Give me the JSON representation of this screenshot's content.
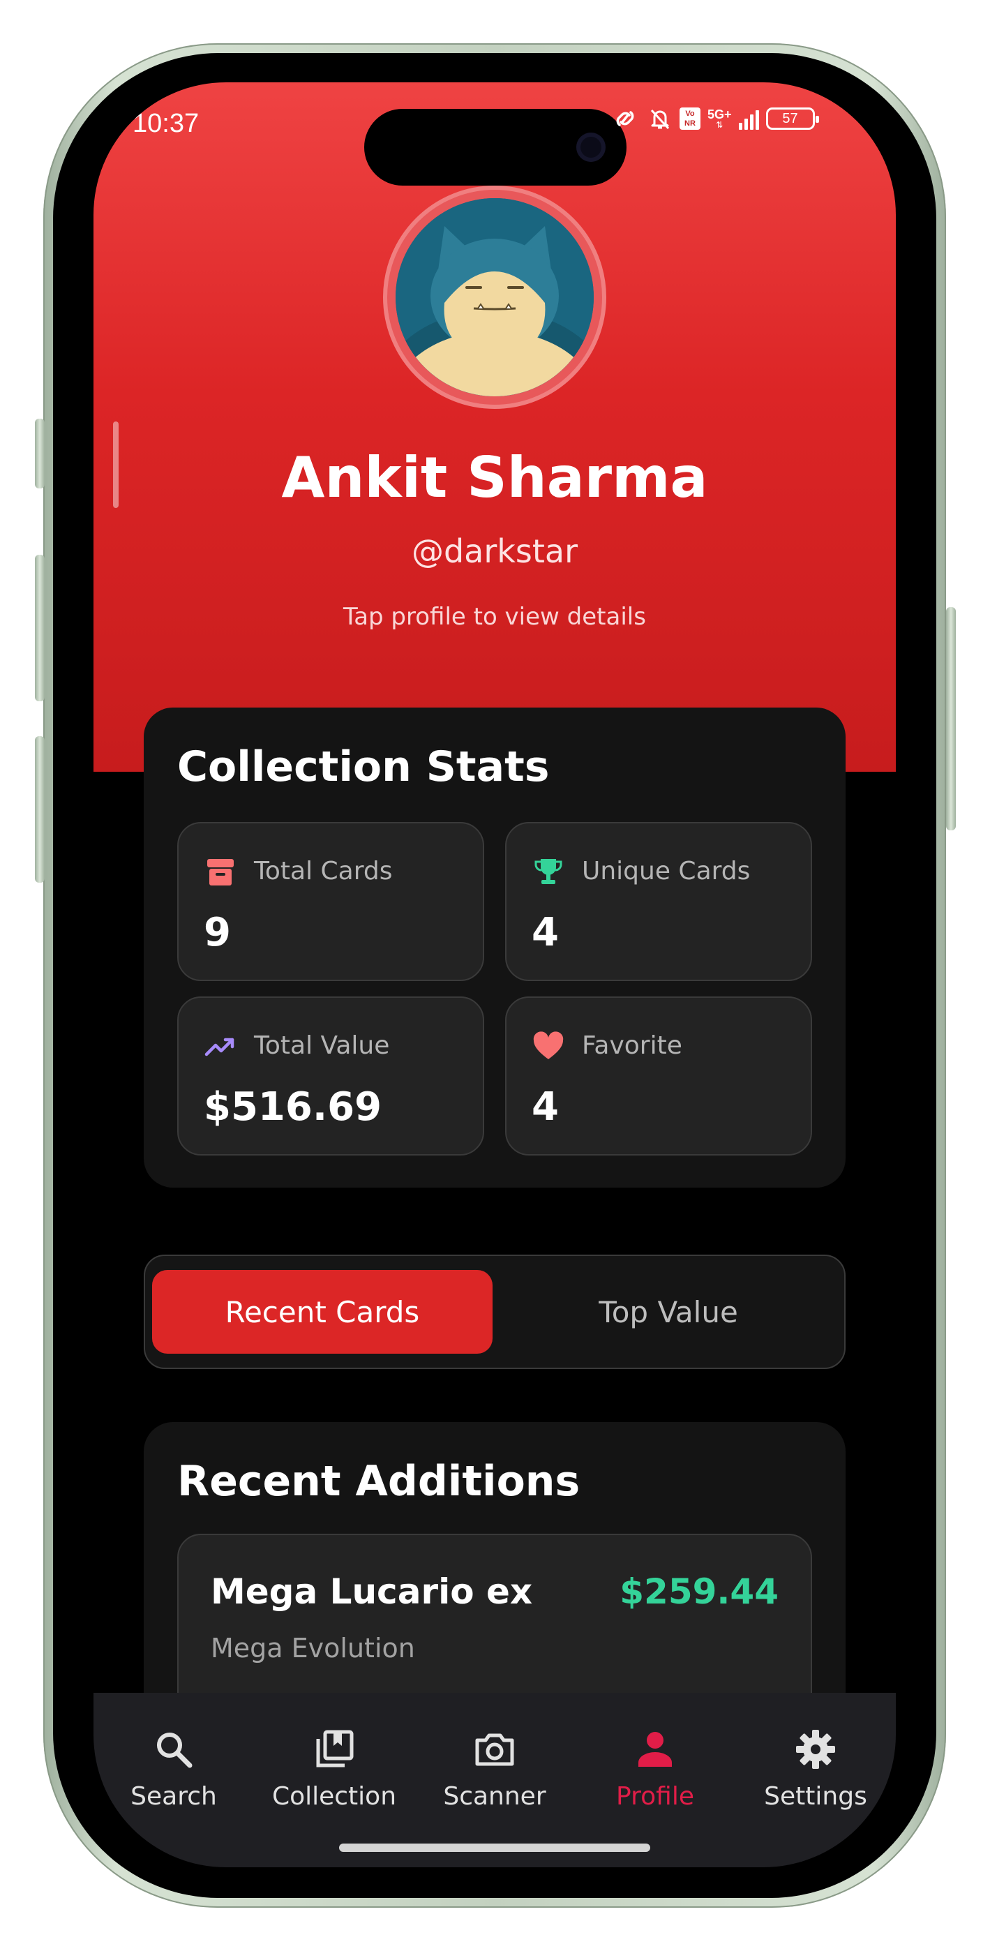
{
  "status_bar": {
    "time": "10:37",
    "network_top": "5G+",
    "volte": "Vo NR",
    "battery": "57"
  },
  "profile": {
    "name": "Ankit Sharma",
    "handle": "@darkstar",
    "hint": "Tap profile to view details"
  },
  "stats": {
    "title": "Collection Stats",
    "total_cards": {
      "label": "Total Cards",
      "value": "9",
      "icon": "archive-icon",
      "color": "#f87171"
    },
    "unique_cards": {
      "label": "Unique Cards",
      "value": "4",
      "icon": "trophy-icon",
      "color": "#34d399"
    },
    "total_value": {
      "label": "Total Value",
      "value": "$516.69",
      "icon": "trending-up-icon",
      "color": "#a78bfa"
    },
    "favorite": {
      "label": "Favorite",
      "value": "4",
      "icon": "heart-icon",
      "color": "#f87171"
    }
  },
  "tabs": {
    "active": "Recent Cards",
    "inactive": "Top Value"
  },
  "recent": {
    "title": "Recent Additions",
    "items": [
      {
        "name": "Mega Lucario ex",
        "price": "$259.44",
        "set": "Mega Evolution"
      }
    ]
  },
  "nav": {
    "items": [
      {
        "label": "Search",
        "icon": "search-icon"
      },
      {
        "label": "Collection",
        "icon": "collection-icon"
      },
      {
        "label": "Scanner",
        "icon": "camera-icon"
      },
      {
        "label": "Profile",
        "icon": "person-icon",
        "active": true
      },
      {
        "label": "Settings",
        "icon": "gear-icon"
      }
    ],
    "active_color": "#e11d48"
  },
  "colors": {
    "accent": "#dc2626",
    "positive": "#34d399"
  }
}
